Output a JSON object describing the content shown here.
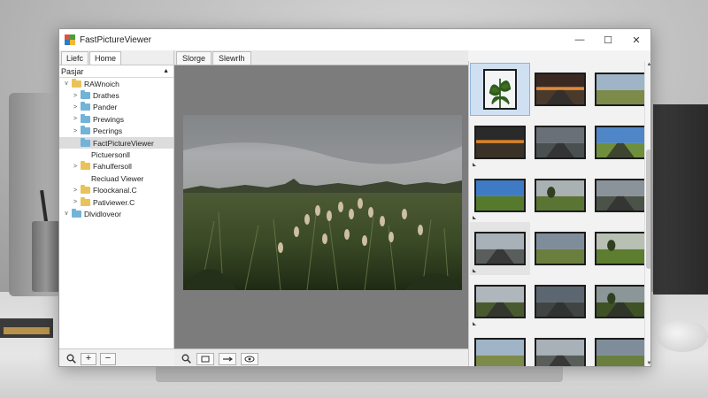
{
  "window": {
    "title": "FastPictureViewer",
    "controls": {
      "minimize": "—",
      "maximize": "☐",
      "close": "✕"
    }
  },
  "left_panel": {
    "tabs": [
      "Liefc",
      "Home"
    ],
    "tree_header": "Pasjar",
    "tree": [
      {
        "label": "RAWnoich",
        "level": 0,
        "twisty": "v",
        "folder_color": "#e9c35a"
      },
      {
        "label": "Drathes",
        "level": 1,
        "twisty": ">",
        "folder_color": "#73b3d8"
      },
      {
        "label": "Pander",
        "level": 1,
        "twisty": ">",
        "folder_color": "#73b3d8"
      },
      {
        "label": "Prewings",
        "level": 1,
        "twisty": ">",
        "folder_color": "#73b3d8"
      },
      {
        "label": "Pecrings",
        "level": 1,
        "twisty": ">",
        "folder_color": "#73b3d8"
      },
      {
        "label": "FactPictureViewer",
        "level": 1,
        "twisty": "",
        "folder_color": "#73b3d8",
        "selected": true
      },
      {
        "label": "Pictuersonll",
        "level": 2,
        "twisty": "",
        "folder_color": ""
      },
      {
        "label": "Fahulfersoll",
        "level": 1,
        "twisty": ">",
        "folder_color": "#e9c35a"
      },
      {
        "label": "Reciuad Viewer",
        "level": 2,
        "twisty": "",
        "folder_color": ""
      },
      {
        "label": "Floockanal.C",
        "level": 1,
        "twisty": ">",
        "folder_color": "#e9c35a"
      },
      {
        "label": "Pativiewer.C",
        "level": 1,
        "twisty": ">",
        "folder_color": "#e9c35a"
      },
      {
        "label": "Dlvidloveor",
        "level": 0,
        "twisty": "v",
        "folder_color": "#73b3d8"
      }
    ],
    "bottom": {
      "search_icon": "search-icon",
      "zoom_in": "+",
      "zoom_out": "−"
    }
  },
  "center_panel": {
    "tabs": [
      "Slorge",
      "Slewrlh"
    ],
    "image_subject": "grass-field-photo"
  },
  "right_panel": {
    "thumbnails": [
      {
        "scene": "plant",
        "selected": true
      },
      {
        "scene": "sunset-road"
      },
      {
        "scene": "field-sky"
      },
      {
        "scene": "sunset-dark"
      },
      {
        "scene": "road-dark"
      },
      {
        "scene": "blue-field"
      },
      {
        "scene": "blue-sky-field"
      },
      {
        "scene": "tree-field"
      },
      {
        "scene": "truck-road"
      },
      {
        "scene": "road-gray",
        "hover": true
      },
      {
        "scene": "cloudy-field"
      },
      {
        "scene": "green-field"
      },
      {
        "scene": "road-trees"
      },
      {
        "scene": "road-dark2"
      },
      {
        "scene": "forest-road"
      },
      {
        "scene": "field-sky"
      },
      {
        "scene": "road-gray"
      },
      {
        "scene": "cloudy-field"
      }
    ]
  },
  "colors": {
    "window_bg": "#f3f3f3",
    "center_bg": "#7c7c7c",
    "selection_blue": "#cfe0f2",
    "folder_yellow": "#e9c35a",
    "folder_blue": "#73b3d8"
  }
}
